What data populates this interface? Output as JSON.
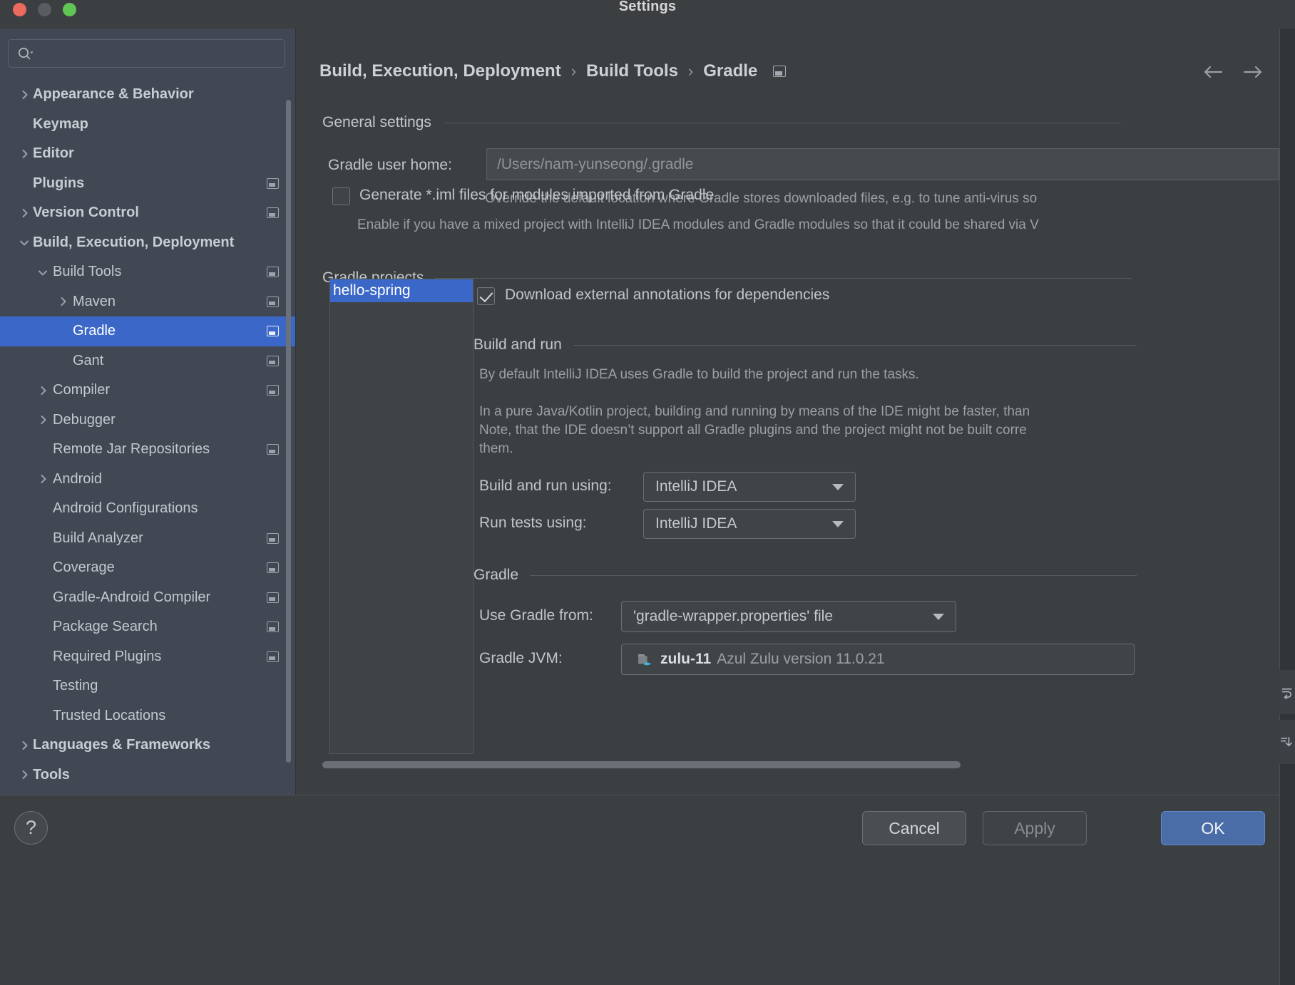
{
  "window": {
    "title": "Settings",
    "traffic_lights": [
      "close-button",
      "minimize-button",
      "zoom-button"
    ]
  },
  "sidebar": {
    "search": {
      "value": "",
      "placeholder": "",
      "icon": "search-icon"
    },
    "items": [
      {
        "label": "Appearance & Behavior",
        "level": 0,
        "chevron": "right",
        "bold": true,
        "badge": false,
        "selected": false
      },
      {
        "label": "Keymap",
        "level": 0,
        "chevron": "none",
        "bold": true,
        "badge": false,
        "selected": false
      },
      {
        "label": "Editor",
        "level": 0,
        "chevron": "right",
        "bold": true,
        "badge": false,
        "selected": false
      },
      {
        "label": "Plugins",
        "level": 0,
        "chevron": "none",
        "bold": true,
        "badge": true,
        "selected": false
      },
      {
        "label": "Version Control",
        "level": 0,
        "chevron": "right",
        "bold": true,
        "badge": true,
        "selected": false
      },
      {
        "label": "Build, Execution, Deployment",
        "level": 0,
        "chevron": "down",
        "bold": true,
        "badge": false,
        "selected": false
      },
      {
        "label": "Build Tools",
        "level": 1,
        "chevron": "down",
        "bold": false,
        "badge": true,
        "selected": false
      },
      {
        "label": "Maven",
        "level": 2,
        "chevron": "right",
        "bold": false,
        "badge": true,
        "selected": false
      },
      {
        "label": "Gradle",
        "level": 3,
        "chevron": "none",
        "bold": false,
        "badge": true,
        "selected": true
      },
      {
        "label": "Gant",
        "level": 3,
        "chevron": "none",
        "bold": false,
        "badge": true,
        "selected": false
      },
      {
        "label": "Compiler",
        "level": 1,
        "chevron": "right",
        "bold": false,
        "badge": true,
        "selected": false
      },
      {
        "label": "Debugger",
        "level": 1,
        "chevron": "right",
        "bold": false,
        "badge": false,
        "selected": false
      },
      {
        "label": "Remote Jar Repositories",
        "level": 1,
        "chevron": "none",
        "bold": false,
        "badge": true,
        "selected": false
      },
      {
        "label": "Android",
        "level": 1,
        "chevron": "right",
        "bold": false,
        "badge": false,
        "selected": false
      },
      {
        "label": "Android Configurations",
        "level": 1,
        "chevron": "none",
        "bold": false,
        "badge": false,
        "selected": false
      },
      {
        "label": "Build Analyzer",
        "level": 1,
        "chevron": "none",
        "bold": false,
        "badge": true,
        "selected": false
      },
      {
        "label": "Coverage",
        "level": 1,
        "chevron": "none",
        "bold": false,
        "badge": true,
        "selected": false
      },
      {
        "label": "Gradle-Android Compiler",
        "level": 1,
        "chevron": "none",
        "bold": false,
        "badge": true,
        "selected": false
      },
      {
        "label": "Package Search",
        "level": 1,
        "chevron": "none",
        "bold": false,
        "badge": true,
        "selected": false
      },
      {
        "label": "Required Plugins",
        "level": 1,
        "chevron": "none",
        "bold": false,
        "badge": true,
        "selected": false
      },
      {
        "label": "Testing",
        "level": 1,
        "chevron": "none",
        "bold": false,
        "badge": false,
        "selected": false
      },
      {
        "label": "Trusted Locations",
        "level": 1,
        "chevron": "none",
        "bold": false,
        "badge": false,
        "selected": false
      },
      {
        "label": "Languages & Frameworks",
        "level": 0,
        "chevron": "right",
        "bold": true,
        "badge": false,
        "selected": false
      },
      {
        "label": "Tools",
        "level": 0,
        "chevron": "right",
        "bold": true,
        "badge": false,
        "selected": false
      }
    ]
  },
  "breadcrumb": {
    "items": [
      "Build, Execution, Deployment",
      "Build Tools",
      "Gradle"
    ],
    "separator": "›",
    "badge_icon": "project-scope-icon"
  },
  "nav": {
    "back_icon": "arrow-left-icon",
    "forward_icon": "arrow-right-icon"
  },
  "general_settings": {
    "group_label": "General settings",
    "gradle_user_home": {
      "label": "Gradle user home:",
      "value": "",
      "placeholder": "/Users/nam-yunseong/.gradle"
    },
    "gradle_user_home_hint": "Override the default location where Gradle stores downloaded files, e.g. to tune anti-virus so",
    "generate_iml": {
      "label": "Generate *.iml files for modules imported from Gradle",
      "checked": false
    },
    "generate_iml_hint": "Enable if you have a mixed project with IntelliJ IDEA modules and Gradle modules so that it could be shared via V"
  },
  "gradle_projects": {
    "group_label": "Gradle projects",
    "projects": [
      "hello-spring"
    ],
    "selected_project": "hello-spring",
    "download_annotations": {
      "label": "Download external annotations for dependencies",
      "checked": true
    },
    "build_and_run": {
      "group_label": "Build and run",
      "paragraph_1": "By default IntelliJ IDEA uses Gradle to build the project and run the tasks.",
      "paragraph_2_line_1": "In a pure Java/Kotlin project, building and running by means of the IDE might be faster, than",
      "paragraph_2_line_2": "Note, that the IDE doesn’t support all Gradle plugins and the project might not be built corre",
      "paragraph_2_line_3": "them.",
      "build_using": {
        "label": "Build and run using:",
        "value": "IntelliJ IDEA"
      },
      "tests_using": {
        "label": "Run tests using:",
        "value": "IntelliJ IDEA"
      }
    },
    "gradle": {
      "group_label": "Gradle",
      "use_gradle_from": {
        "label": "Use Gradle from:",
        "value": "'gradle-wrapper.properties' file"
      },
      "gradle_jvm": {
        "label": "Gradle JVM:",
        "name": "zulu-11",
        "description": "Azul Zulu version 11.0.21",
        "icon": "jdk-folder-icon"
      }
    }
  },
  "footer": {
    "help_label": "?",
    "cancel_label": "Cancel",
    "apply_label": "Apply",
    "ok_label": "OK"
  },
  "right_strip": {
    "icons": [
      "run-anything-icon",
      "download-icon"
    ]
  },
  "colors": {
    "accent_selection": "#3b68c8",
    "ok_button": "#4a6da8",
    "sidebar_bg": "#414854",
    "panel_bg": "#3c3f41",
    "text_primary": "#c3c7cd",
    "text_muted": "#9aa0a6"
  }
}
